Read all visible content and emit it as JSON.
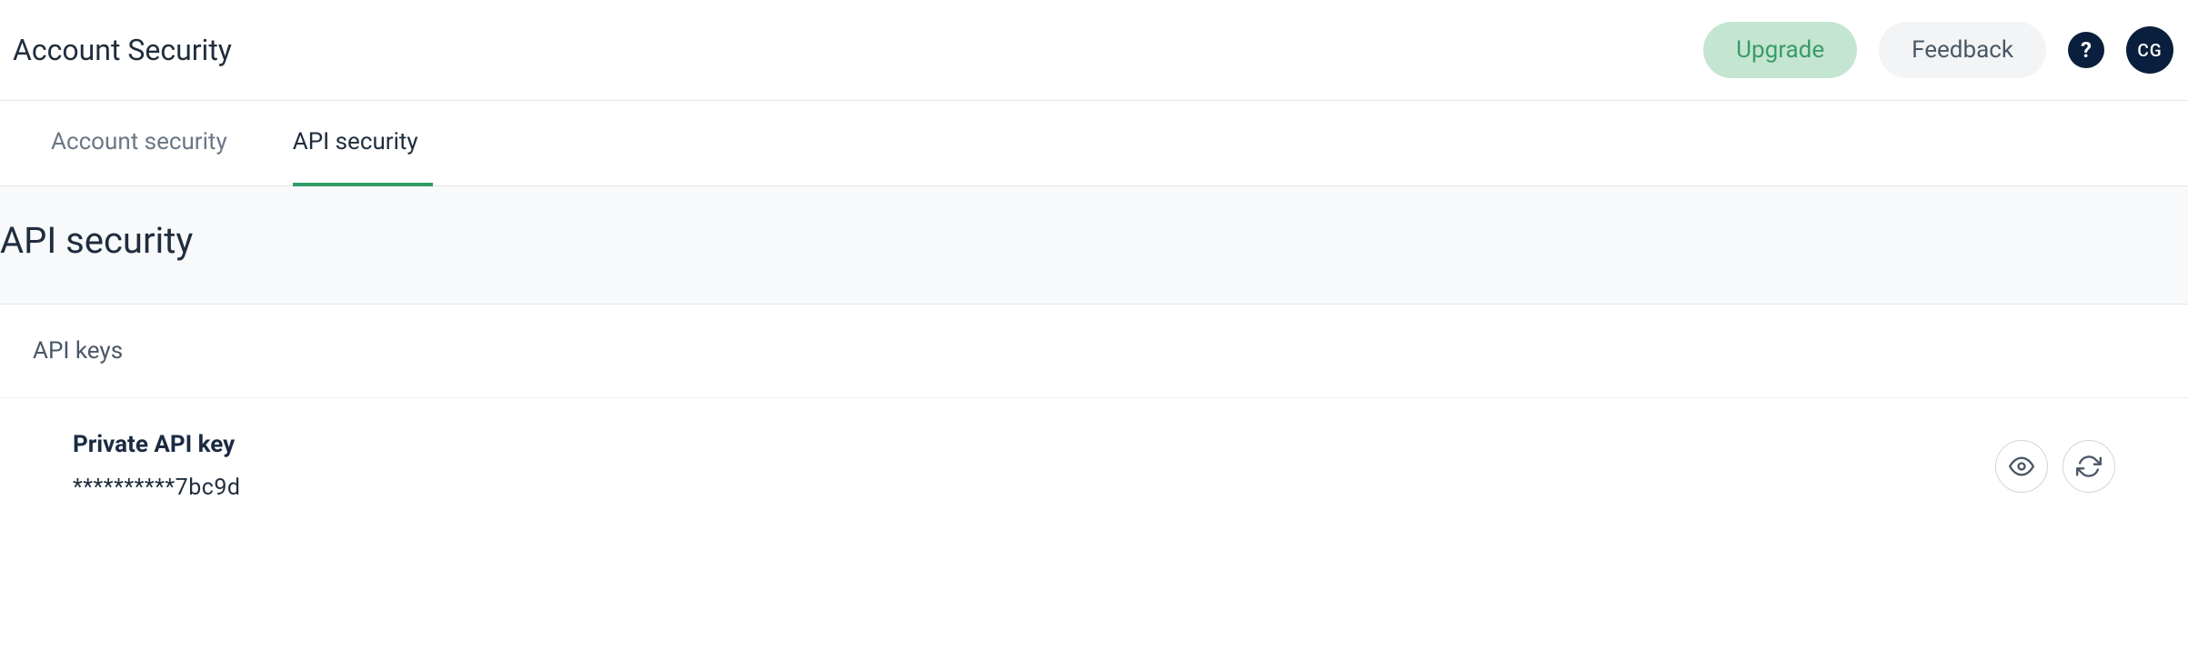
{
  "header": {
    "title": "Account Security",
    "upgrade_label": "Upgrade",
    "feedback_label": "Feedback",
    "help_glyph": "?",
    "avatar_initials": "CG"
  },
  "tabs": [
    {
      "label": "Account security",
      "active": false
    },
    {
      "label": "API security",
      "active": true
    }
  ],
  "section": {
    "title": "API security"
  },
  "subsection": {
    "title": "API keys"
  },
  "api_key": {
    "label": "Private API key",
    "masked_value": "**********7bc9d"
  }
}
